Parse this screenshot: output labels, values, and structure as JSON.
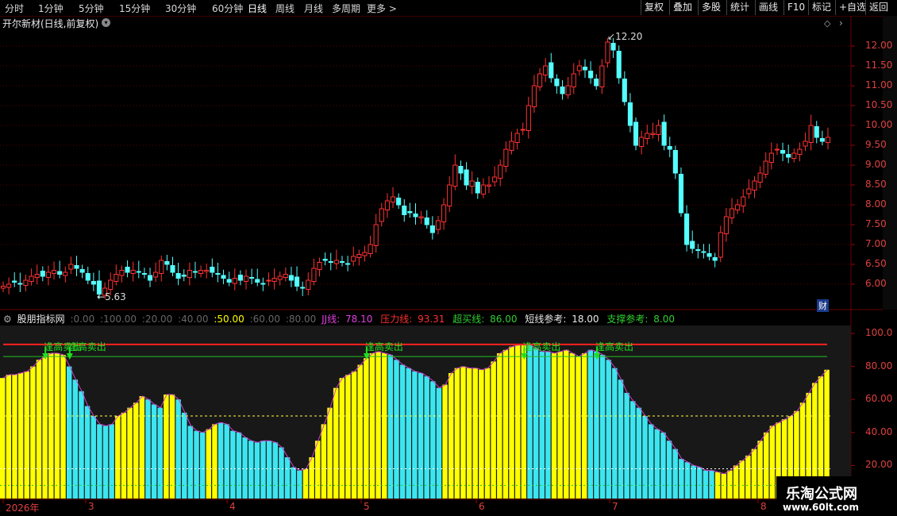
{
  "toolbar": {
    "timeframes": [
      "分时",
      "1分钟",
      "5分钟",
      "15分钟",
      "30分钟",
      "60分钟",
      "日线",
      "周线",
      "月线",
      "多周期",
      "更多 >"
    ],
    "buttons": [
      "复权",
      "叠加",
      "多股",
      "统计",
      "画线",
      "F10",
      "标记",
      "+自选",
      "返回"
    ]
  },
  "stock": {
    "title": "开尔新材(日线,前复权)"
  },
  "price_ticks": [
    "12.00",
    "11.50",
    "11.00",
    "10.50",
    "10.00",
    "9.50",
    "9.00",
    "8.50",
    "8.00",
    "7.50",
    "7.00",
    "6.50",
    "6.00"
  ],
  "annotations": {
    "high": "12.20",
    "low": "5.63"
  },
  "badge": "财",
  "right_strip": [
    "",
    ""
  ],
  "indicator": {
    "name": "股朋指标网",
    "params": [
      ":0.00",
      ":100.00",
      ":20.00",
      ":40.00",
      ":50.00",
      ":60.00",
      ":80.00"
    ],
    "values": [
      {
        "label": "JJ线:",
        "value": "78.10",
        "color": "#e040e0"
      },
      {
        "label": "压力线:",
        "value": "93.31",
        "color": "#ff3030"
      },
      {
        "label": "超买线:",
        "value": "86.00",
        "color": "#30d030"
      },
      {
        "label": "短线参考:",
        "value": "18.00",
        "color": "#e8e8e8"
      },
      {
        "label": "支撑参考:",
        "value": "8.00",
        "color": "#30d030"
      }
    ],
    "ticks": [
      "100.0",
      "80.00",
      "60.00",
      "40.00",
      "20.00"
    ],
    "signal_text": "逢高卖出"
  },
  "x_axis": [
    "2026年",
    "3",
    "4",
    "5",
    "6",
    "7",
    "8"
  ],
  "watermark": {
    "line1": "乐淘公式网",
    "line2": "www.60lt.com"
  },
  "colors": {
    "up": "#ff3232",
    "down": "#54ffff",
    "yellow": "#ffff00",
    "cyan": "#3ce6f0"
  },
  "chart_data": [
    {
      "type": "candlestick",
      "title": "开尔新材(日线,前复权)",
      "ylim": [
        5.6,
        12.4
      ],
      "close": [
        5.95,
        6.0,
        6.05,
        6.0,
        6.1,
        6.2,
        6.25,
        6.2,
        6.3,
        6.35,
        6.25,
        6.3,
        6.5,
        6.4,
        6.3,
        6.1,
        6.0,
        5.75,
        5.9,
        6.1,
        6.25,
        6.35,
        6.3,
        6.35,
        6.3,
        6.25,
        6.1,
        6.3,
        6.6,
        6.5,
        6.3,
        6.15,
        6.2,
        6.35,
        6.3,
        6.35,
        6.35,
        6.3,
        6.25,
        6.15,
        6.05,
        6.15,
        6.1,
        6.2,
        6.15,
        6.05,
        6.0,
        6.1,
        6.15,
        6.2,
        6.25,
        6.1,
        5.95,
        5.9,
        6.1,
        6.4,
        6.55,
        6.6,
        6.55,
        6.6,
        6.55,
        6.5,
        6.7,
        6.75,
        6.8,
        7.0,
        7.5,
        7.9,
        8.1,
        8.2,
        8.0,
        7.75,
        7.8,
        7.7,
        7.7,
        7.5,
        7.3,
        7.6,
        8.0,
        8.5,
        9.0,
        8.8,
        8.5,
        8.6,
        8.3,
        8.5,
        8.5,
        8.7,
        9.0,
        9.4,
        9.6,
        9.8,
        9.9,
        10.5,
        11.0,
        11.3,
        11.5,
        11.2,
        11.0,
        10.8,
        11.0,
        11.3,
        11.5,
        11.4,
        11.2,
        11.0,
        11.5,
        12.1,
        11.9,
        11.2,
        10.6,
        10.0,
        9.5,
        9.7,
        9.8,
        9.8,
        10.0,
        9.5,
        9.4,
        8.8,
        7.8,
        7.0,
        6.9,
        6.85,
        6.8,
        6.7,
        6.6,
        7.3,
        7.7,
        7.9,
        8.0,
        8.2,
        8.4,
        8.6,
        8.8,
        9.1,
        9.3,
        9.4,
        9.3,
        9.2,
        9.3,
        9.4,
        9.6,
        10.0,
        9.7,
        9.6,
        9.7
      ],
      "high": 12.2,
      "low": 5.63
    },
    {
      "type": "bar",
      "title": "股朋指标网",
      "ylim": [
        0,
        100
      ],
      "reference_lines": {
        "压力线": 93.31,
        "超买线": 86.0,
        "50线": 50.0,
        "短线参考": 18.0,
        "支撑参考": 8.0
      },
      "values": [
        73,
        75,
        75,
        76,
        77,
        80,
        84,
        86,
        88,
        88,
        87,
        80,
        72,
        65,
        56,
        50,
        45,
        44,
        45,
        50,
        52,
        55,
        58,
        62,
        60,
        57,
        55,
        63,
        63,
        60,
        52,
        44,
        41,
        40,
        42,
        45,
        46,
        45,
        41,
        40,
        37,
        35,
        34,
        35,
        35,
        34,
        31,
        25,
        19,
        17,
        18,
        25,
        35,
        45,
        55,
        67,
        73,
        75,
        77,
        81,
        85,
        88,
        89,
        88,
        87,
        84,
        81,
        79,
        77,
        76,
        74,
        71,
        67,
        69,
        76,
        79,
        80,
        79,
        79,
        78,
        79,
        83,
        88,
        90,
        92,
        93,
        93,
        93,
        91,
        89,
        89,
        88,
        89,
        90,
        88,
        86,
        88,
        90,
        89,
        87,
        84,
        79,
        72,
        64,
        59,
        55,
        50,
        45,
        42,
        40,
        35,
        30,
        24,
        22,
        20,
        19,
        17,
        17,
        16,
        15,
        17,
        20,
        23,
        26,
        30,
        35,
        40,
        44,
        46,
        48,
        50,
        53,
        58,
        64,
        70,
        74,
        78
      ],
      "yellow_mask": [
        1,
        1,
        1,
        1,
        1,
        1,
        1,
        1,
        1,
        1,
        1,
        0,
        0,
        0,
        0,
        0,
        0,
        0,
        0,
        1,
        1,
        1,
        1,
        1,
        0,
        0,
        0,
        1,
        1,
        0,
        0,
        0,
        0,
        0,
        1,
        1,
        0,
        0,
        0,
        0,
        0,
        0,
        0,
        0,
        0,
        0,
        0,
        0,
        0,
        0,
        1,
        1,
        1,
        1,
        1,
        1,
        1,
        1,
        1,
        1,
        1,
        1,
        1,
        1,
        0,
        0,
        0,
        0,
        0,
        0,
        0,
        0,
        0,
        1,
        1,
        1,
        1,
        1,
        1,
        1,
        1,
        1,
        1,
        1,
        1,
        1,
        1,
        0,
        0,
        0,
        0,
        1,
        1,
        1,
        1,
        1,
        1,
        0,
        0,
        0,
        0,
        0,
        0,
        0,
        0,
        0,
        0,
        0,
        0,
        0,
        0,
        0,
        0,
        0,
        0,
        0,
        0,
        0,
        1,
        1,
        1,
        1,
        1,
        1,
        1,
        1,
        1,
        1,
        1,
        1,
        1,
        1,
        1,
        1,
        1,
        1,
        1,
        1,
        1,
        1,
        1
      ],
      "signals": [
        "逢高卖出",
        "逢高卖出",
        "逢高卖出",
        "逢高卖出",
        "逢高卖出"
      ]
    }
  ]
}
